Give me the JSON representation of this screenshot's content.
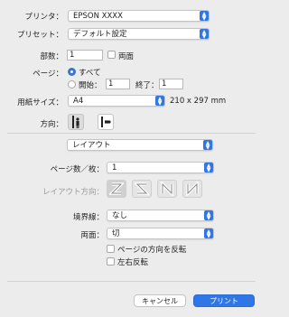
{
  "printer": {
    "label": "プリンタ：",
    "value": "EPSON XXXX"
  },
  "preset": {
    "label": "プリセット：",
    "value": "デフォルト設定"
  },
  "copies": {
    "label": "部数：",
    "value": "1",
    "duplex_label": "両面"
  },
  "pages": {
    "label": "ページ：",
    "all_label": "すべて",
    "from_label": "開始：",
    "from_value": "1",
    "to_label": "終了：",
    "to_value": "1"
  },
  "paper": {
    "label": "用紙サイズ：",
    "value": "A4",
    "dimensions": "210 x 297 mm"
  },
  "orientation": {
    "label": "方向："
  },
  "section": {
    "value": "レイアウト"
  },
  "layout": {
    "pages_per_sheet_label": "ページ数／枚：",
    "pages_per_sheet_value": "1",
    "direction_label": "レイアウト方向：",
    "border_label": "境界線：",
    "border_value": "なし",
    "duplex_label": "両面：",
    "duplex_value": "切",
    "reverse_orientation_label": "ページの方向を反転",
    "flip_horizontal_label": "左右反転"
  },
  "buttons": {
    "cancel": "キャンセル",
    "print": "プリント"
  },
  "colors": {
    "accent": "#2f76e6",
    "background": "#ececec"
  }
}
